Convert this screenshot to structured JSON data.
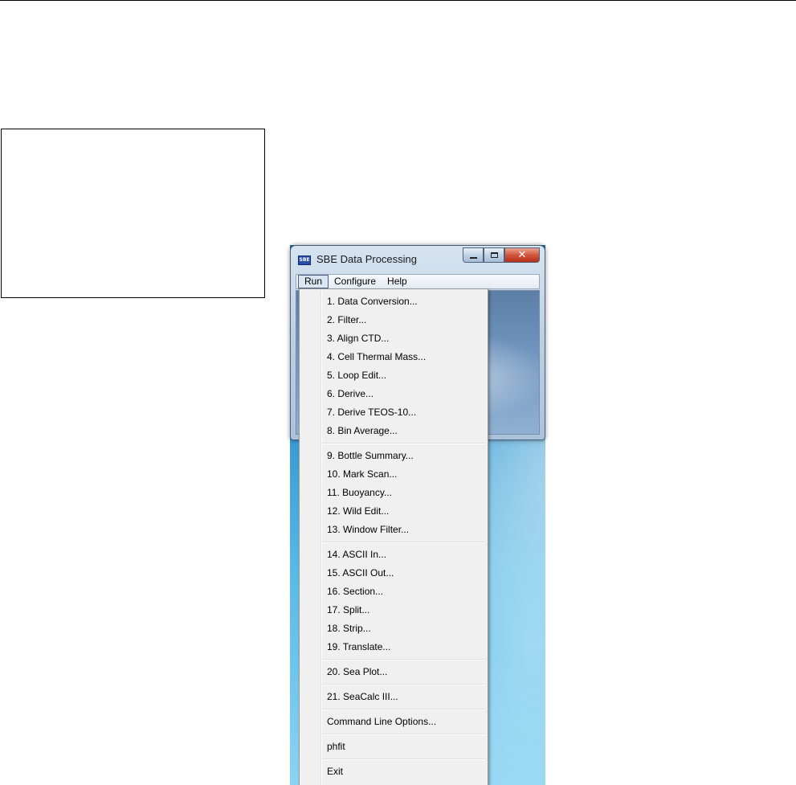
{
  "window": {
    "title": "SBE Data Processing",
    "icon": "sbe-app-icon",
    "icon_text": "SBE",
    "caption_buttons": [
      "minimize-icon",
      "maximize-icon",
      "close-icon"
    ],
    "close_glyph": "✕"
  },
  "menubar": {
    "items": [
      {
        "label": "Run",
        "active": true
      },
      {
        "label": "Configure",
        "active": false
      },
      {
        "label": "Help",
        "active": false
      }
    ]
  },
  "run_menu": {
    "groups": [
      [
        "1. Data Conversion...",
        "2. Filter...",
        "3. Align CTD...",
        "4. Cell Thermal Mass...",
        "5. Loop Edit...",
        "6. Derive...",
        "7. Derive TEOS-10...",
        "8. Bin Average..."
      ],
      [
        "9. Bottle Summary...",
        "10. Mark Scan...",
        "11. Buoyancy...",
        "12. Wild Edit...",
        "13. Window Filter..."
      ],
      [
        "14. ASCII In...",
        "15. ASCII Out...",
        "16. Section...",
        "17. Split...",
        "18. Strip...",
        "19. Translate..."
      ],
      [
        "20. Sea Plot..."
      ],
      [
        "21. SeaCalc III..."
      ],
      [
        "Command Line Options..."
      ],
      [
        "phfit"
      ],
      [
        "Exit"
      ]
    ]
  }
}
